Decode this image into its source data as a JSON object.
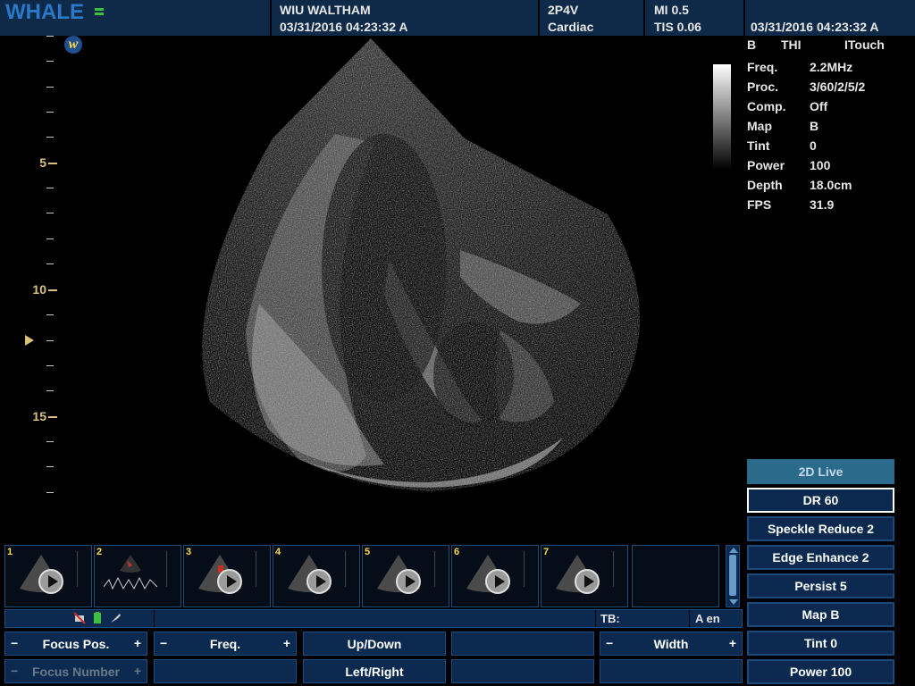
{
  "header": {
    "logo_text": "WHALE",
    "badge": "w",
    "institution": "WIU WALTHAM",
    "datetime_left": "03/31/2016  04:23:32 A",
    "probe": "2P4V",
    "preset": "Cardiac",
    "mi": "MI   0.5",
    "tis": "TIS 0.06",
    "datetime_right": "03/31/2016  04:23:32 A"
  },
  "ruler": {
    "labels": [
      "5",
      "10",
      "15"
    ]
  },
  "modes": {
    "b": "B",
    "thi": "THI",
    "itouch": "ITouch"
  },
  "params": [
    {
      "key": "Freq.",
      "value": "2.2MHz"
    },
    {
      "key": "Proc.",
      "value": "3/60/2/5/2"
    },
    {
      "key": "Comp.",
      "value": "Off"
    },
    {
      "key": "Map",
      "value": "B"
    },
    {
      "key": "Tint",
      "value": "0"
    },
    {
      "key": "Power",
      "value": "100"
    },
    {
      "key": "Depth",
      "value": "18.0cm"
    },
    {
      "key": "FPS",
      "value": "31.9"
    }
  ],
  "right_buttons": [
    "2D Live",
    "DR 60",
    "Speckle Reduce 2",
    "Edge Enhance 2",
    "Persist 5",
    "Map B",
    "Tint 0",
    "Power 100"
  ],
  "thumbnails": [
    "1",
    "2",
    "3",
    "4",
    "5",
    "6",
    "7"
  ],
  "status": {
    "tb": "TB:",
    "lang": "A  en"
  },
  "controls": {
    "focus_pos": "Focus Pos.",
    "freq": "Freq.",
    "up_down": "Up/Down",
    "width": "Width",
    "focus_number": "Focus Number",
    "left_right": "Left/Right",
    "minus": "−",
    "plus": "+"
  },
  "colors": {
    "header_bg": "#0f2a48",
    "button_bg": "#0c2a50",
    "ruler_accent": "#d8c27a",
    "live_button": "#2a6a8a"
  }
}
